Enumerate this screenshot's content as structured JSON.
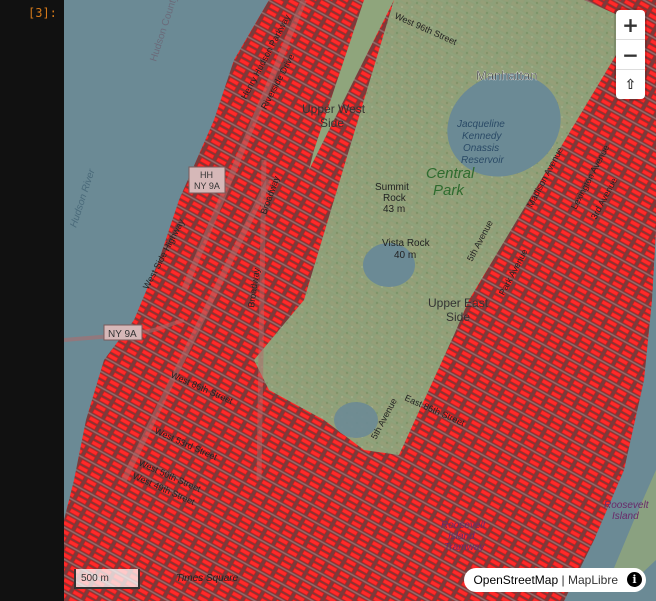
{
  "notebook": {
    "prompt": "[3]:"
  },
  "map": {
    "controls": {
      "zoom_in": "+",
      "zoom_out": "−",
      "reset_north": "⇧"
    },
    "scale_label": "500 m",
    "attribution": {
      "osm": "OpenStreetMap",
      "separator": "|",
      "maplibre": "MapLibre",
      "info": "i"
    },
    "labels": {
      "manhattan": "Manhattan",
      "upper_west_1": "Upper West",
      "upper_west_2": "Side",
      "reservoir_1": "Jacqueline",
      "reservoir_2": "Kennedy",
      "reservoir_3": "Onassis",
      "reservoir_4": "Reservoir",
      "central_1": "Central",
      "central_2": "Park",
      "summit_1": "Summit",
      "summit_2": "Rock",
      "summit_3": "43 m",
      "vista_1": "Vista Rock",
      "vista_2": "40 m",
      "upper_east_1": "Upper East",
      "upper_east_2": "Side",
      "hudson_river": "Hudson River",
      "hudson_county": "Hudson County",
      "hh": "HH",
      "ny9a_shield": "NY 9A",
      "ny9a_label": "NY 9A",
      "west_side_hwy": "West Side Highway",
      "henry_hudson": "Henry Hudson Parkway",
      "riverside": "Riverside Drive",
      "broadway_1": "Broadway",
      "broadway_2": "Broadway",
      "w86": "West 86th Street",
      "w96": "West 96th Street",
      "w53": "West 53rd Street",
      "w50": "West 50th Street",
      "w49": "West 49th Street",
      "fifth_ave": "5th Avenue",
      "park_ave": "Park Avenue",
      "madison_ave": "Madison Avenue",
      "lexington_ave": "Lexington Avenue",
      "third_ave": "3rd Avenue",
      "fifth_ave_2": "5th Avenue",
      "e86": "East 86th Street",
      "roosevelt_1": "Roosevelt",
      "roosevelt_2": "Island",
      "roosevelt_3": "Tramway",
      "roosevelt_island_1": "Roosevelt",
      "roosevelt_island_2": "Island",
      "times_square": "Times Square"
    }
  },
  "colors": {
    "water": "#aad3df",
    "park": "#c8e2b4",
    "overlay_red": "#ff1e1e",
    "land": "#e6dfd6"
  }
}
